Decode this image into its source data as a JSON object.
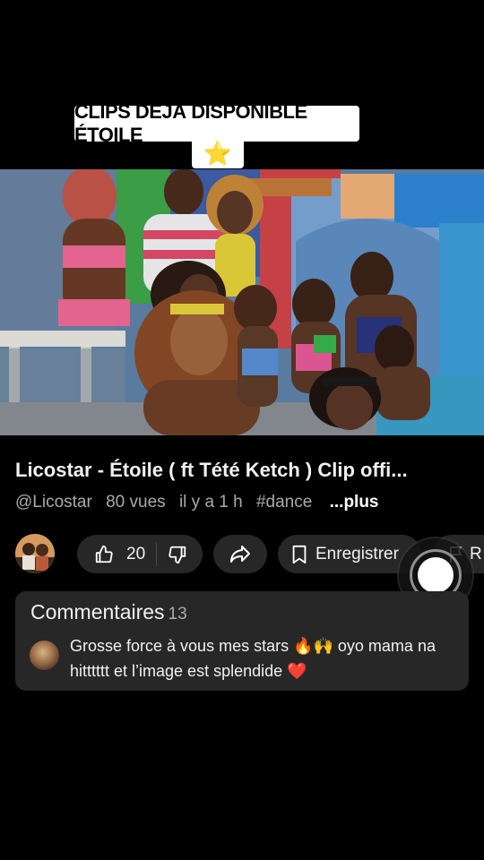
{
  "banner": {
    "text": "CLIPS DÉJÀ DISPONIBLE ÉTOILE",
    "emoji": "⭐"
  },
  "video": {
    "description": "music video thumbnail"
  },
  "video_info": {
    "title": "Licostar - Étoile ( ft Tété Ketch ) Clip offi...",
    "channel": "@Licostar",
    "views": "80 vues",
    "time": "il y a 1 h",
    "hashtag": "#dance",
    "more": "...plus"
  },
  "actions": {
    "like_count": "20",
    "save_label": "Enregistrer",
    "report_label": "R"
  },
  "comments": {
    "title": "Commentaires",
    "count": "13",
    "first_comment": "Grosse force à vous mes stars 🔥🙌 oyo mama na hitttttt et l’image est splendide ❤️"
  },
  "icons": {
    "like": "thumbs-up-icon",
    "dislike": "thumbs-down-icon",
    "share": "share-icon",
    "save": "bookmark-icon",
    "report": "flag-icon",
    "record": "record-button"
  },
  "colors": {
    "background": "#000000",
    "pill": "#272727",
    "meta": "#aaaaaa"
  }
}
